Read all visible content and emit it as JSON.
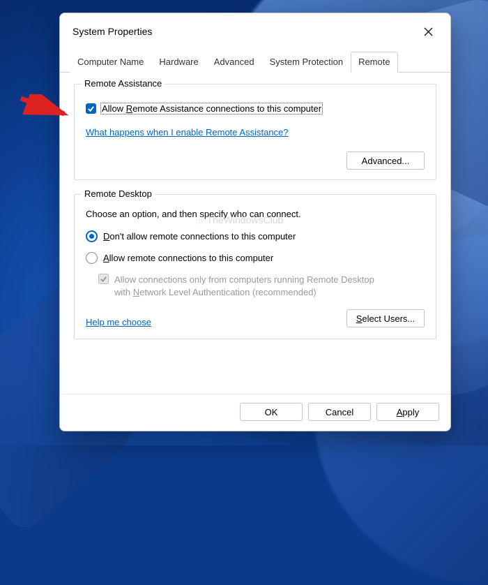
{
  "window": {
    "title": "System Properties"
  },
  "tabs": {
    "items": [
      "Computer Name",
      "Hardware",
      "Advanced",
      "System Protection",
      "Remote"
    ],
    "active": 4
  },
  "remote_assistance": {
    "legend": "Remote Assistance",
    "allow_label_pre": "Allow ",
    "allow_label_key": "R",
    "allow_label_post": "emote Assistance connections to this computer",
    "allow_checked": true,
    "help_link": "What happens when I enable Remote Assistance?",
    "advanced_btn": "Advanced..."
  },
  "remote_desktop": {
    "legend": "Remote Desktop",
    "desc": "Choose an option, and then specify who can connect.",
    "radio_dont_key": "D",
    "radio_dont_text": "on't allow remote connections to this computer",
    "radio_allow_key": "A",
    "radio_allow_text": "llow remote connections to this computer",
    "radio_selected": "dont",
    "nested_check_text_1": "Allow connections only from computers running Remote Desktop",
    "nested_check_text_2_pre": "with ",
    "nested_check_text_2_key": "N",
    "nested_check_text_2_post": "etwork Level Authentication (recommended)",
    "nested_checked": true,
    "help_link": "Help me choose",
    "select_users_key": "S",
    "select_users_text": "elect Users..."
  },
  "buttons": {
    "ok": "OK",
    "cancel": "Cancel",
    "apply_key": "A",
    "apply_text": "pply"
  },
  "watermark": "TheWindowsClub"
}
